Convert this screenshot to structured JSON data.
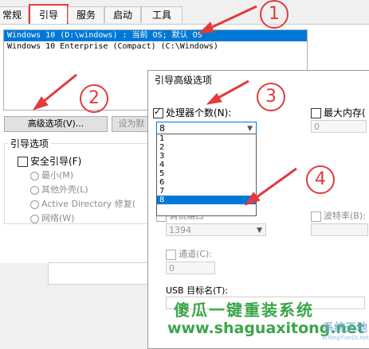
{
  "tabs": [
    {
      "label": "常规"
    },
    {
      "label": "引导"
    },
    {
      "label": "服务"
    },
    {
      "label": "启动"
    },
    {
      "label": "工具"
    }
  ],
  "os_list": [
    {
      "text": "Windows 10 (D:\\windows) : 当前 OS; 默认 OS",
      "selected": true
    },
    {
      "text": "Windows 10 Enterprise (Compact) (C:\\Windows)",
      "selected": false
    }
  ],
  "buttons": {
    "advanced": "高级选项(V)...",
    "set_default": "设为默"
  },
  "boot_options": {
    "label": "引导选项",
    "safe_boot": "安全引导(F)",
    "minimal": "最小(M)",
    "alternate_shell": "其他外壳(L)",
    "active_directory": "Active Directory 修复(",
    "network": "网络(W)"
  },
  "dialog": {
    "title": "引导高级选项",
    "num_processors_label": "处理器个数(N):",
    "num_processors_value": "8",
    "max_memory_label": "最大内存(",
    "max_memory_value": "0",
    "processor_options": [
      "1",
      "2",
      "3",
      "4",
      "5",
      "6",
      "7",
      "8"
    ],
    "selected_option": "8",
    "debug_port_label": "调试端口",
    "debug_port_value": "1394",
    "baud_rate_label": "波特率(B):",
    "channel_label": "通道(C):",
    "channel_value": "0",
    "usb_target_label": "USB 目标名(T):"
  },
  "markers": [
    "1",
    "2",
    "3",
    "4"
  ],
  "watermark": {
    "line1": "傻瓜一键重装系统",
    "line2": "www.shaguaxitong.net",
    "logo_text": "系统天地",
    "logo_url": "XiTongTianDi.net"
  },
  "colors": {
    "accent": "#0078d7",
    "annotation_red": "#e23b3b",
    "watermark_green": "#3aa64a"
  }
}
